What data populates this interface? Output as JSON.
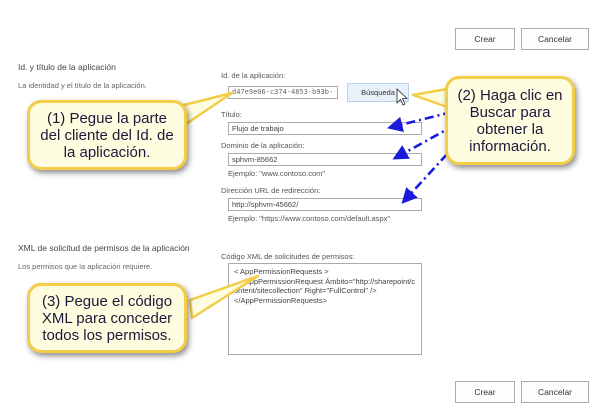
{
  "top_buttons": {
    "create": "Crear",
    "cancel": "Cancelar"
  },
  "bottom_buttons": {
    "create": "Crear",
    "cancel": "Cancelar"
  },
  "app_section": {
    "title": "Id. y título de la aplicación",
    "description": "La identidad y el título de la aplicación.",
    "app_id": {
      "label": "Id. de la aplicación:",
      "value": "d47e9e06-c374-4853-b93b-",
      "lookup_button": "Búsqueda"
    },
    "title_field": {
      "label": "Título:",
      "value": "Flujo de trabajo"
    },
    "domain_field": {
      "label": "Dominio de la aplicación:",
      "value": "sphvm-85662",
      "hint": "Ejemplo: \"www.contoso.com\""
    },
    "redirect_field": {
      "label": "Dirección URL de redirección:",
      "value": "http://sphvm-45662/",
      "hint": "Ejemplo: \"https://www.contoso.com/default.aspx\""
    }
  },
  "permissions_section": {
    "title": "XML de solicitud de permisos de la aplicación",
    "description": "Los permisos que la aplicación requiere.",
    "xml_label": "Código XML de solicitudes de permisos:",
    "xml_value": "< AppPermissionRequests >\n   <AppPermissionRequest Ámbito=\"http://sharepoint/content/sitecollection\" Right=\"FullControl\" />\n</AppPermissionRequests>"
  },
  "callouts": {
    "paste_client_id": "(1) Pegue la parte del cliente del Id. de la aplicación.",
    "click_lookup": "(2) Haga clic en Buscar para obtener la información.",
    "paste_xml": "(3) Pegue el código XML para conceder todos los permisos."
  },
  "colors": {
    "callout_fill": "#fffde0",
    "callout_border": "#f3cc48",
    "arrow": "#1a1adc",
    "lookup_button": "#e8f1fa"
  }
}
